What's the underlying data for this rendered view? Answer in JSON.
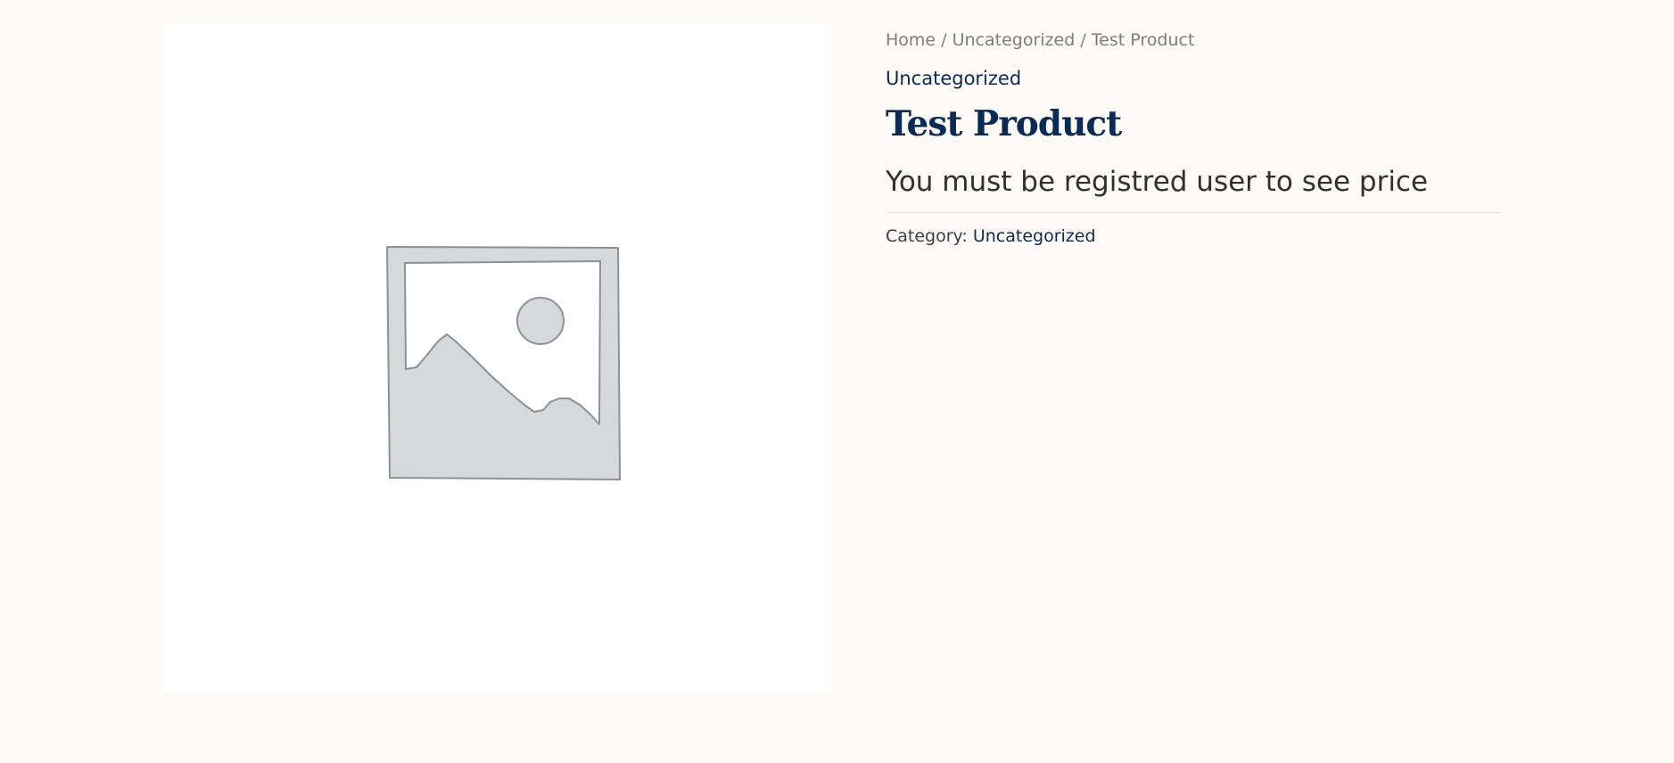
{
  "product_image": {
    "icon": "image-placeholder-icon",
    "colors": {
      "fill": "#d6d9dc",
      "stroke": "#8e9093",
      "inner": "#ffffff"
    }
  },
  "breadcrumb": {
    "items": [
      "Home",
      "Uncategorized",
      "Test Product"
    ],
    "separator": "/"
  },
  "product": {
    "category_link": "Uncategorized",
    "title": "Test Product",
    "price_notice": "You must be registred user to see price",
    "meta": {
      "label": "Category:",
      "category": "Uncategorized"
    }
  },
  "colors": {
    "background": "#fdf9f7",
    "brand_navy": "#0c2b53",
    "text_dark": "#303030",
    "text_muted": "#7d7d7d"
  }
}
